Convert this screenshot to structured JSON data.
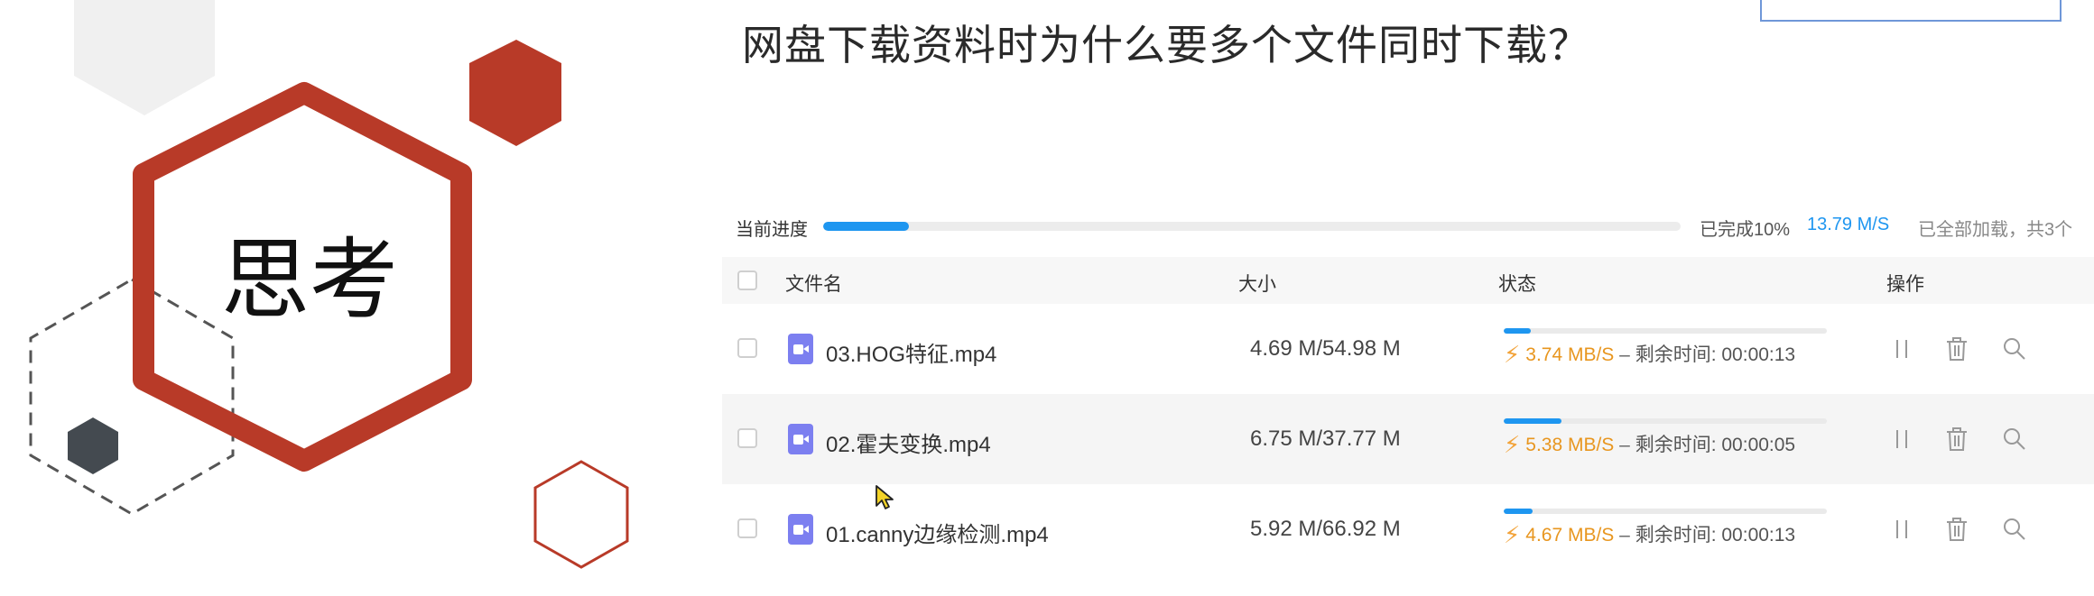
{
  "slide": {
    "think_label": "思考",
    "question": "网盘下载资料时为什么要多个文件同时下载？"
  },
  "progress": {
    "label": "当前进度",
    "percent": 10,
    "completed_text": "已完成10%",
    "speed": "13.79 M/S",
    "loaded_text": "已全部加载，共3个"
  },
  "table": {
    "headers": {
      "name": "文件名",
      "size": "大小",
      "status": "状态",
      "actions": "操作"
    }
  },
  "files": [
    {
      "name": "03.HOG特征.mp4",
      "size": "4.69 M/54.98 M",
      "progress": 0.085,
      "speed": "3.74 MB/S",
      "dash": "–",
      "remaining": "剩余时间: 00:00:13"
    },
    {
      "name": "02.霍夫变换.mp4",
      "size": "6.75 M/37.77 M",
      "progress": 0.179,
      "speed": "5.38 MB/S",
      "dash": "–",
      "remaining": "剩余时间: 00:00:05"
    },
    {
      "name": "01.canny边缘检测.mp4",
      "size": "5.92 M/66.92 M",
      "progress": 0.088,
      "speed": "4.67 MB/S",
      "dash": "–",
      "remaining": "剩余时间: 00:00:13"
    }
  ],
  "icons": {
    "file_type": "video-file-icon",
    "speed": "lightning-icon",
    "pause": "pause-icon",
    "delete": "trash-icon",
    "locate": "search-icon"
  },
  "colors": {
    "accent_red": "#b83a28",
    "progress_blue": "#1e96f0",
    "speed_orange": "#e8961f",
    "file_icon_purple": "#7c7ff0"
  }
}
